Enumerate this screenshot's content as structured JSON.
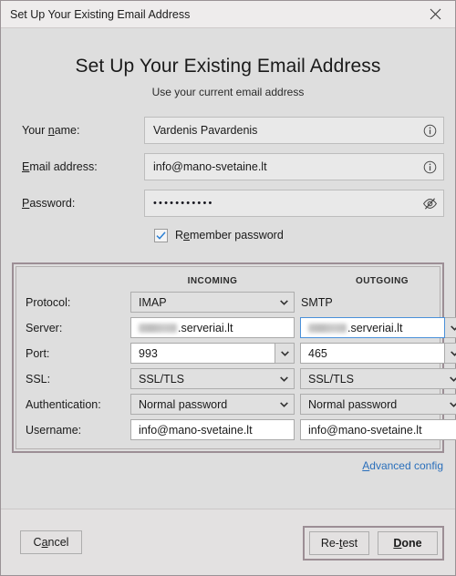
{
  "window": {
    "title": "Set Up Your Existing Email Address",
    "close_icon": "close-icon"
  },
  "page": {
    "heading": "Set Up Your Existing Email Address",
    "subheading": "Use your current email address"
  },
  "form": {
    "name": {
      "label_pre": "Your ",
      "label_acc": "n",
      "label_post": "ame:",
      "value": "Vardenis Pavardenis",
      "icon": "info-icon"
    },
    "email": {
      "label_pre": "",
      "label_acc": "E",
      "label_post": "mail address:",
      "value": "info@mano-svetaine.lt",
      "icon": "info-icon"
    },
    "password": {
      "label_pre": "",
      "label_acc": "P",
      "label_post": "assword:",
      "value": "•••••••••••",
      "icon": "eye-hidden-icon"
    },
    "remember": {
      "label_pre": "R",
      "label_acc": "e",
      "label_post": "member password",
      "checked": true,
      "check_icon": "checkmark-icon"
    }
  },
  "settings": {
    "columns": {
      "incoming": "INCOMING",
      "outgoing": "OUTGOING"
    },
    "rows": [
      {
        "label": "Protocol:",
        "incoming": {
          "value": "IMAP",
          "control": "combobox",
          "style": "gray"
        },
        "outgoing": {
          "value": "SMTP",
          "control": "static"
        }
      },
      {
        "label": "Server:",
        "incoming": {
          "value": ".serveriai.lt",
          "redacted_prefix": true,
          "control": "textbox"
        },
        "outgoing": {
          "value": ".serveriai.lt",
          "redacted_prefix": true,
          "control": "split-combobox",
          "focused": true
        }
      },
      {
        "label": "Port:",
        "incoming": {
          "value": "993",
          "control": "split-combobox"
        },
        "outgoing": {
          "value": "465",
          "control": "split-combobox"
        }
      },
      {
        "label": "SSL:",
        "incoming": {
          "value": "SSL/TLS",
          "control": "combobox",
          "style": "gray"
        },
        "outgoing": {
          "value": "SSL/TLS",
          "control": "combobox",
          "style": "gray"
        }
      },
      {
        "label": "Authentication:",
        "incoming": {
          "value": "Normal password",
          "control": "combobox",
          "style": "gray"
        },
        "outgoing": {
          "value": "Normal password",
          "control": "combobox",
          "style": "gray"
        }
      },
      {
        "label": "Username:",
        "incoming": {
          "value": "info@mano-svetaine.lt",
          "control": "textbox"
        },
        "outgoing": {
          "value": "info@mano-svetaine.lt",
          "control": "textbox"
        }
      }
    ],
    "advanced_link": {
      "acc": "A",
      "rest": "dvanced config"
    }
  },
  "footer": {
    "cancel": {
      "pre": "C",
      "acc": "a",
      "post": "ncel"
    },
    "retest": {
      "pre": "Re-",
      "acc": "t",
      "post": "est"
    },
    "done": {
      "pre": "",
      "acc": "D",
      "post": "one"
    }
  },
  "colors": {
    "accent_link": "#2a6fbb",
    "focus_border": "#4a90d9",
    "highlight_border": "#9c8e95",
    "checkmark": "#2a7fd4",
    "window_bg": "#dedede"
  }
}
